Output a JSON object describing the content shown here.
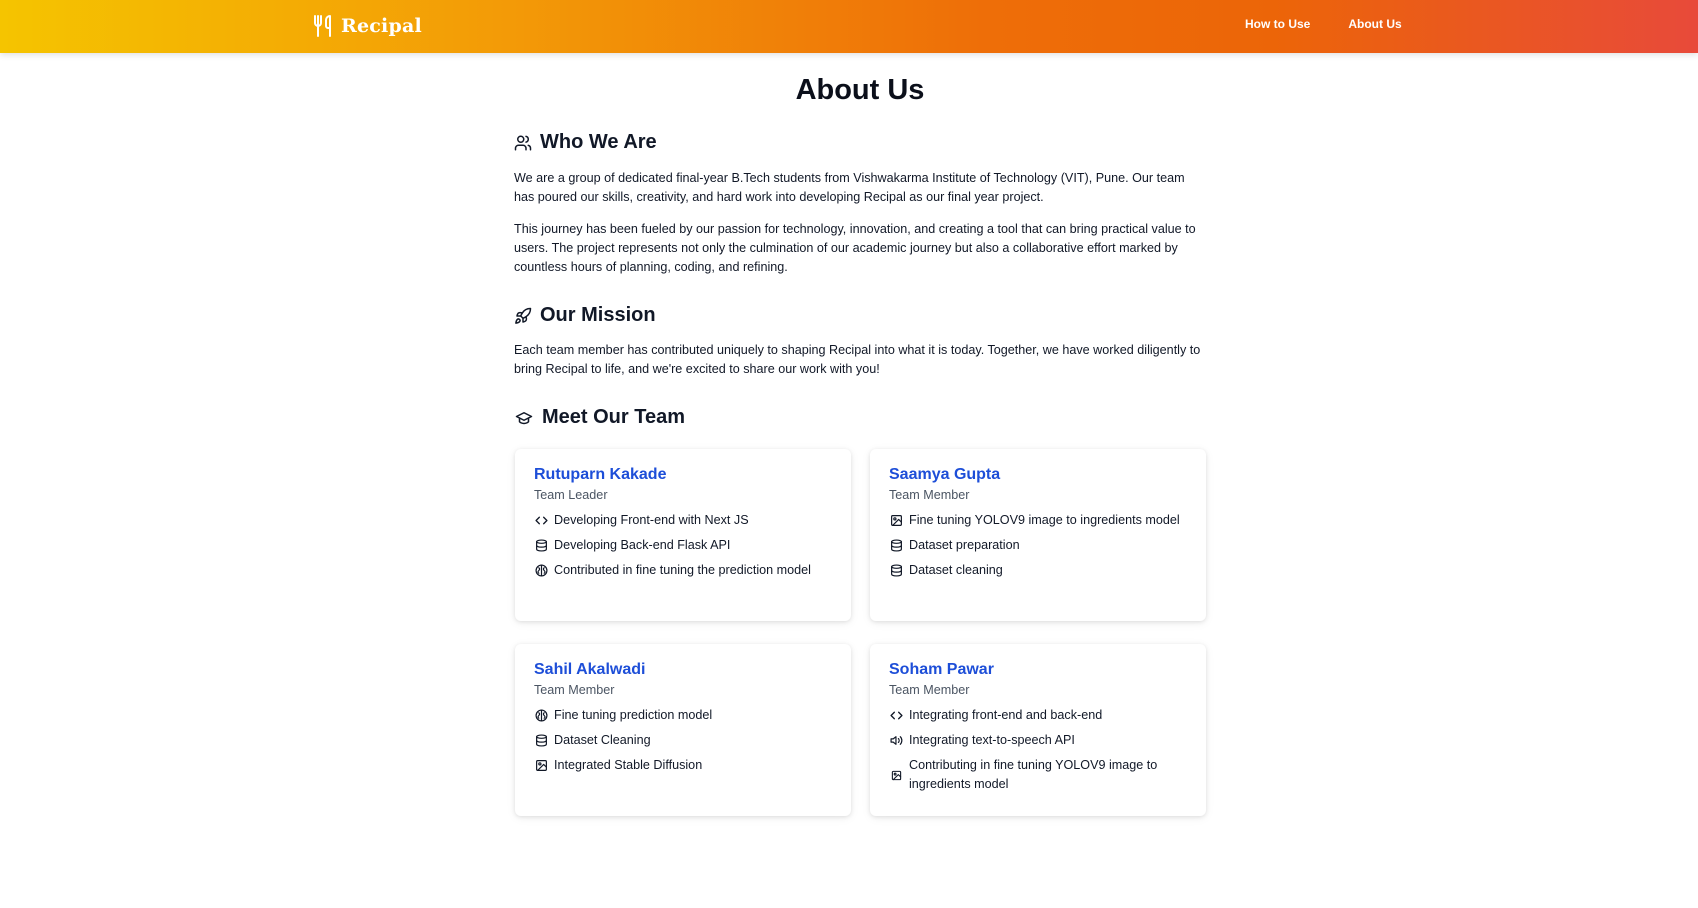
{
  "header": {
    "brand_name": "Recipal",
    "nav": [
      {
        "label": "How to Use"
      },
      {
        "label": "About Us"
      }
    ]
  },
  "page": {
    "title": "About Us"
  },
  "who_we_are": {
    "heading": "Who We Are",
    "paragraph_1": "We are a group of dedicated final-year B.Tech students from Vishwakarma Institute of Technology (VIT), Pune. Our team has poured our skills, creativity, and hard work into developing Recipal as our final year project.",
    "paragraph_2": "This journey has been fueled by our passion for technology, innovation, and creating a tool that can bring practical value to users. The project represents not only the culmination of our academic journey but also a collaborative effort marked by countless hours of planning, coding, and refining."
  },
  "mission": {
    "heading": "Our Mission",
    "paragraph": "Each team member has contributed uniquely to shaping Recipal into what it is today. Together, we have worked diligently to bring Recipal to life, and we're excited to share our work with you!"
  },
  "team": {
    "heading": "Meet Our Team",
    "members": [
      {
        "name": "Rutuparn Kakade",
        "role": "Team Leader",
        "items": [
          {
            "icon": "code-icon",
            "text": "Developing Front-end with Next JS"
          },
          {
            "icon": "database-icon",
            "text": "Developing Back-end Flask API"
          },
          {
            "icon": "brain-icon",
            "text": "Contributed in fine tuning the prediction model"
          }
        ]
      },
      {
        "name": "Saamya Gupta",
        "role": "Team Member",
        "items": [
          {
            "icon": "image-icon",
            "text": "Fine tuning YOLOV9 image to ingredients model"
          },
          {
            "icon": "database-icon",
            "text": "Dataset preparation"
          },
          {
            "icon": "database-icon",
            "text": "Dataset cleaning"
          }
        ]
      },
      {
        "name": "Sahil Akalwadi",
        "role": "Team Member",
        "items": [
          {
            "icon": "brain-icon",
            "text": "Fine tuning prediction model"
          },
          {
            "icon": "database-icon",
            "text": "Dataset Cleaning"
          },
          {
            "icon": "image-icon",
            "text": "Integrated Stable Diffusion"
          }
        ]
      },
      {
        "name": "Soham Pawar",
        "role": "Team Member",
        "items": [
          {
            "icon": "code-icon",
            "text": "Integrating front-end and back-end"
          },
          {
            "icon": "speaker-icon",
            "text": "Integrating text-to-speech API"
          },
          {
            "icon": "image-icon",
            "text": "Contributing in fine tuning YOLOV9 image to ingredients model"
          }
        ]
      }
    ]
  },
  "colors": {
    "gradient_start": "#f5c400",
    "gradient_mid": "#ee6e08",
    "gradient_end": "#e84a3a",
    "member_name": "#1d4ed8"
  }
}
